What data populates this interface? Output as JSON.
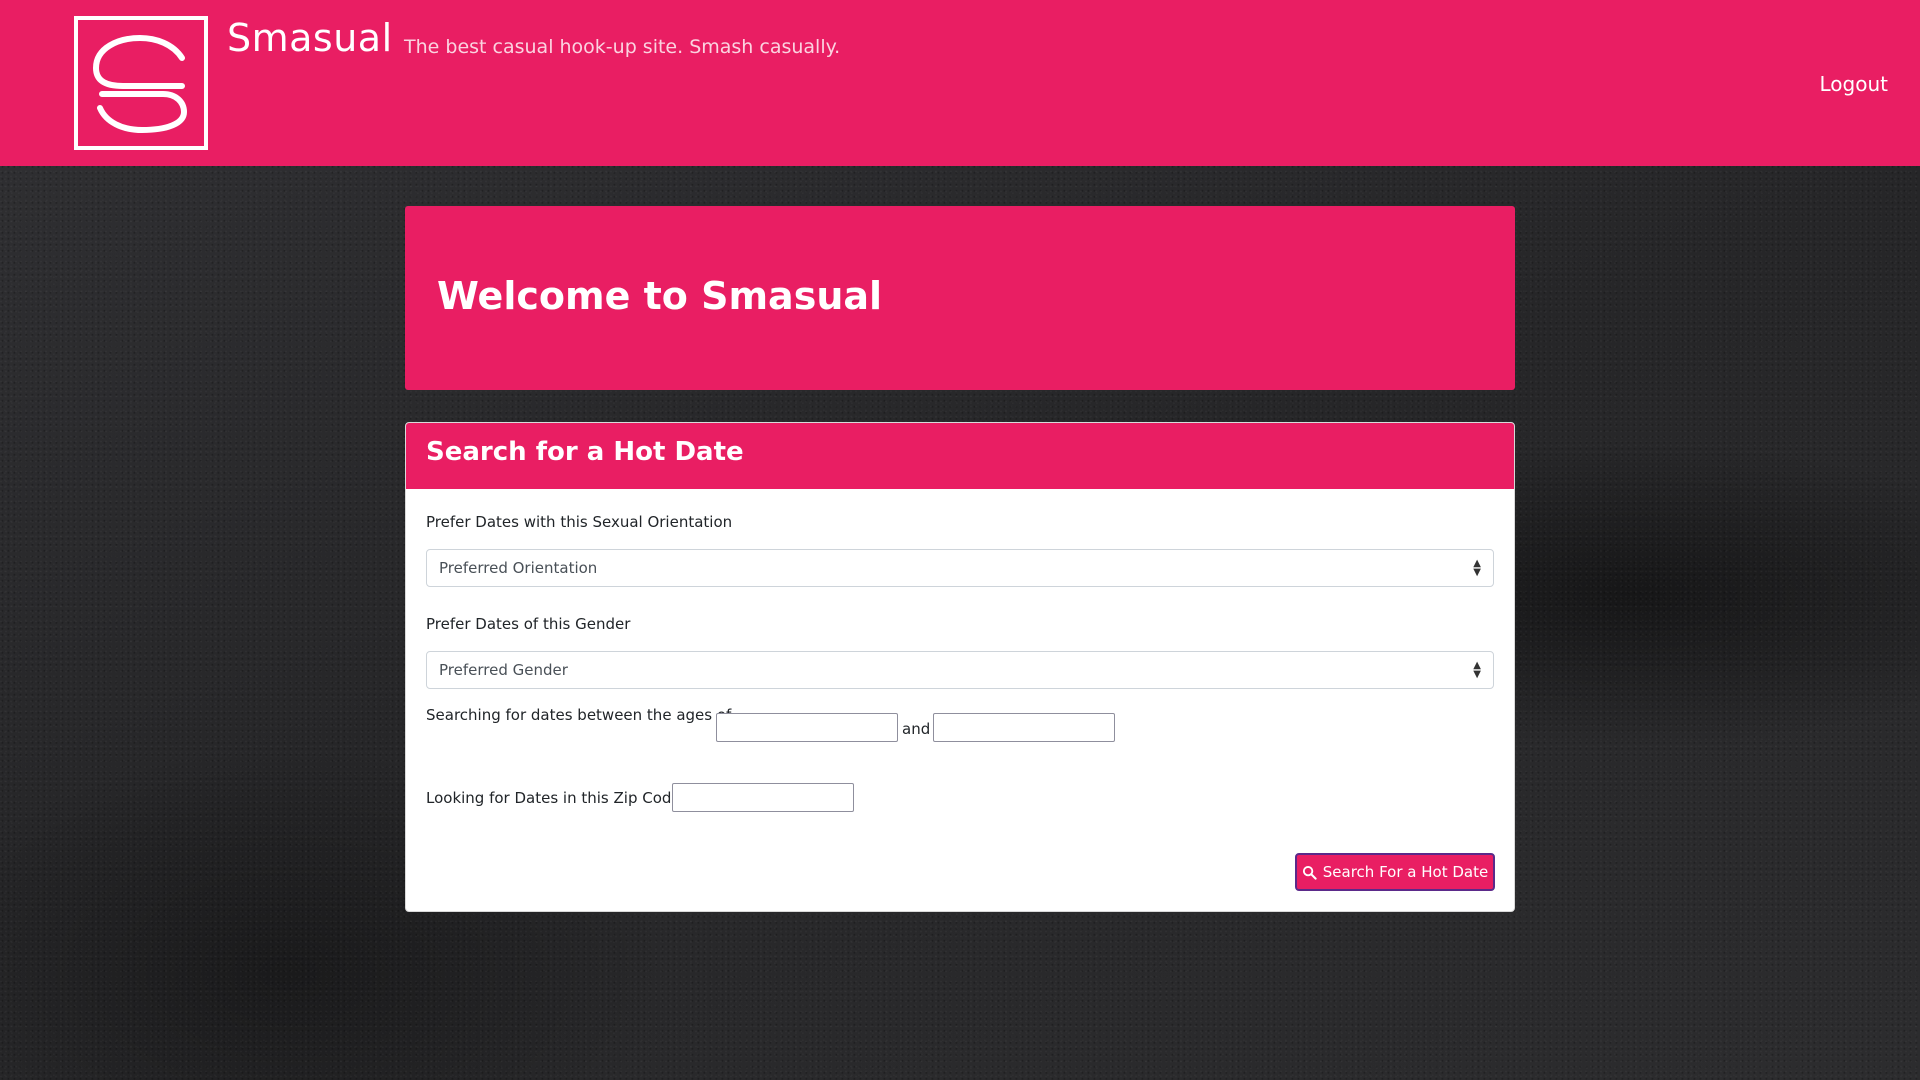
{
  "header": {
    "brand": "Smasual",
    "tagline": "The best casual hook-up site. Smash casually.",
    "logout_label": "Logout",
    "logo_icon": "smasual-s-logo-icon"
  },
  "jumbotron": {
    "title": "Welcome to Smasual"
  },
  "search_card": {
    "title": "Search for a Hot Date",
    "orientation_label": "Prefer Dates with this Sexual Orientation",
    "orientation_value": "Preferred Orientation",
    "gender_label": "Prefer Dates of this Gender",
    "gender_value": "Preferred Gender",
    "age_label": "Searching for dates between the ages of",
    "age_and": "and",
    "age_min_value": "",
    "age_max_value": "",
    "zip_label": "Looking for Dates in this Zip Code",
    "zip_value": "",
    "submit_label": "Search For a Hot Date",
    "submit_icon": "search-icon"
  },
  "colors": {
    "brand_pink": "#e91e63",
    "button_border": "#5b2a8a",
    "background": "#2a2a2c"
  }
}
